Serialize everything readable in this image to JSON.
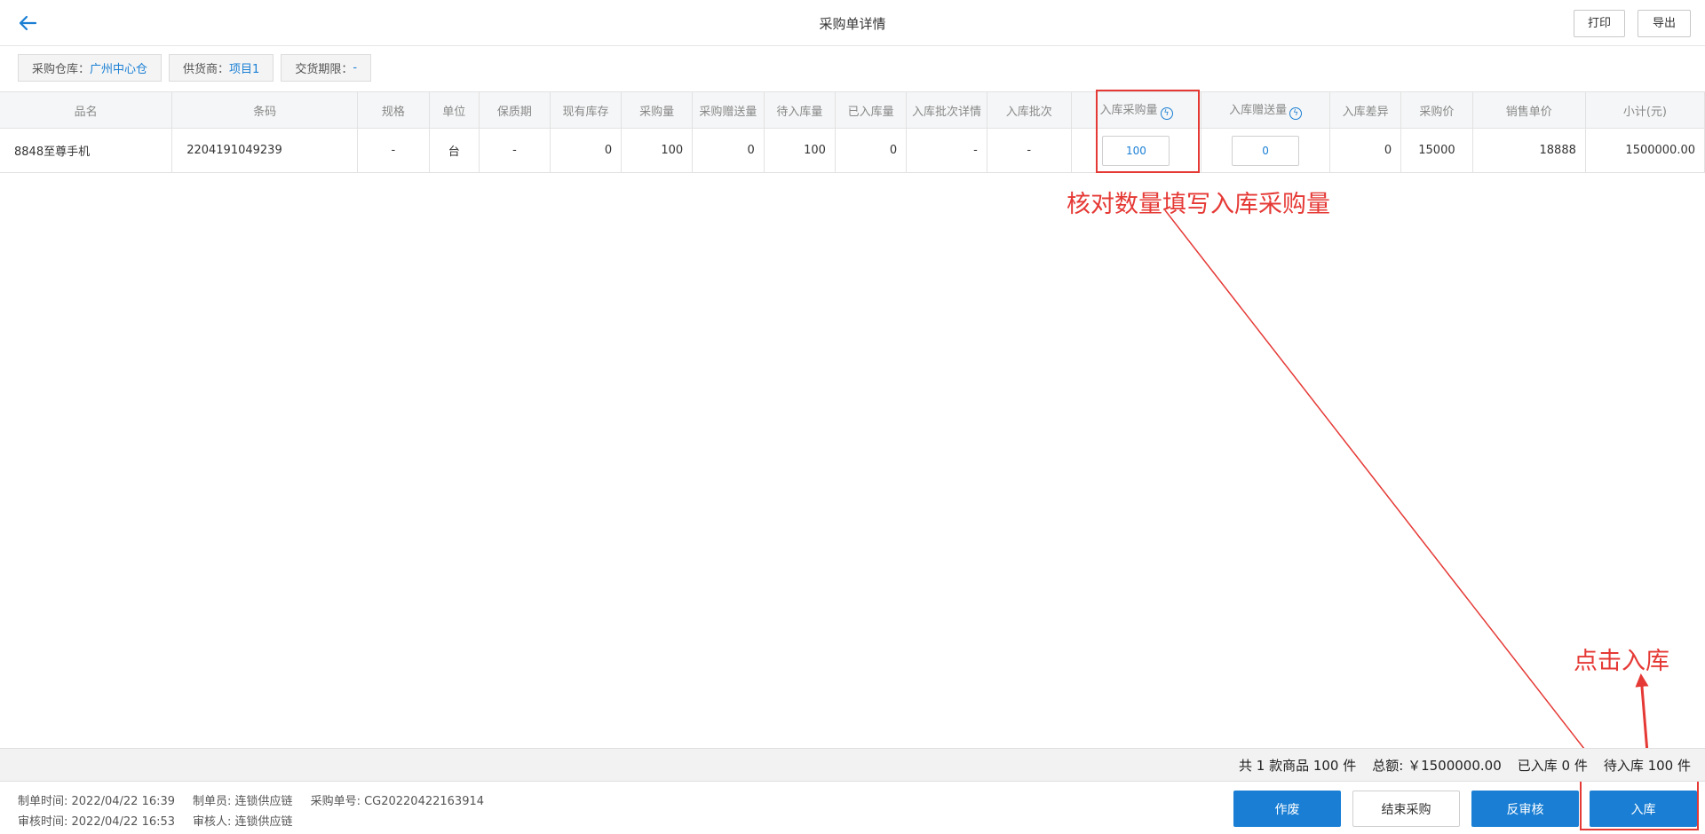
{
  "header": {
    "title": "采购单详情",
    "back_icon": "arrow-left-icon",
    "print_label": "打印",
    "export_label": "导出"
  },
  "filters": [
    {
      "key": "采购仓库：",
      "value": "广州中心仓"
    },
    {
      "key": "供货商：",
      "value": "项目1"
    },
    {
      "key": "交货期限：",
      "value": "-"
    }
  ],
  "table": {
    "columns": [
      "品名",
      "条码",
      "规格",
      "单位",
      "保质期",
      "现有库存",
      "采购量",
      "采购赠送量",
      "待入库量",
      "已入库量",
      "入库批次详情",
      "入库批次",
      "入库采购量",
      "入库赠送量",
      "入库差异",
      "采购价",
      "销售单价",
      "小计(元)"
    ],
    "rows": [
      {
        "name": "8848至尊手机",
        "barcode": "2204191049239",
        "spec": "-",
        "unit": "台",
        "shelf_life": "-",
        "stock": "0",
        "purchase_qty": "100",
        "purchase_gift_qty": "0",
        "pending_qty": "100",
        "received_qty": "0",
        "batch_detail": "-",
        "batch": "-",
        "in_purchase_qty": "100",
        "in_gift_qty": "0",
        "diff": "0",
        "purchase_price": "15000",
        "sale_price": "18888",
        "subtotal": "1500000.00"
      }
    ]
  },
  "annotations": {
    "check_qty_note": "核对数量填写入库采购量",
    "click_instock_note": "点击入库",
    "color": "#e53935"
  },
  "summary": {
    "count": "共 1 款商品 100 件",
    "total": "总额: ￥1500000.00",
    "received": "已入库 0 件",
    "pending": "待入库 100 件"
  },
  "meta": {
    "created_time": "制单时间: 2022/04/22 16:39",
    "creator": "制单员: 连锁供应链",
    "order_no": "采购单号: CG20220422163914",
    "audit_time": "审核时间: 2022/04/22 16:53",
    "auditor": "审核人: 连锁供应链"
  },
  "actions": {
    "void_label": "作废",
    "end_label": "结束采购",
    "unaudit_label": "反审核",
    "instock_label": "入库"
  },
  "theme": {
    "accent": "#1a7fd4"
  }
}
